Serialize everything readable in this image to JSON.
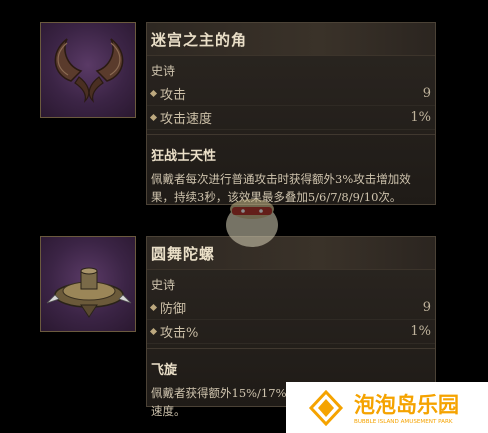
{
  "items": [
    {
      "title": "迷宫之主的角",
      "rarity": "史诗",
      "stats": [
        {
          "label": "攻击",
          "value": "9"
        },
        {
          "label": "攻击速度",
          "value": "1%"
        }
      ],
      "trait_name": "狂战士天性",
      "trait_desc": "佩戴者每次进行普通攻击时获得额外3%攻击增加效果，持续3秒，该效果最多叠加5/6/7/8/9/10次。",
      "icon": "horns-icon"
    },
    {
      "title": "圆舞陀螺",
      "rarity": "史诗",
      "stats": [
        {
          "label": "防御",
          "value": "9"
        },
        {
          "label": "攻击%",
          "value": "1%"
        }
      ],
      "trait_name": "飞旋",
      "trait_desc": "佩戴者获得额外15%/17%/19%/21%/23%/25%攻击速度。",
      "icon": "spinning-top-icon"
    }
  ],
  "watermark": {
    "name": "泡泡岛乐园",
    "subtitle": "BUBBLE ISLAND AMUSEMENT PARK",
    "color": "#f5a300"
  }
}
